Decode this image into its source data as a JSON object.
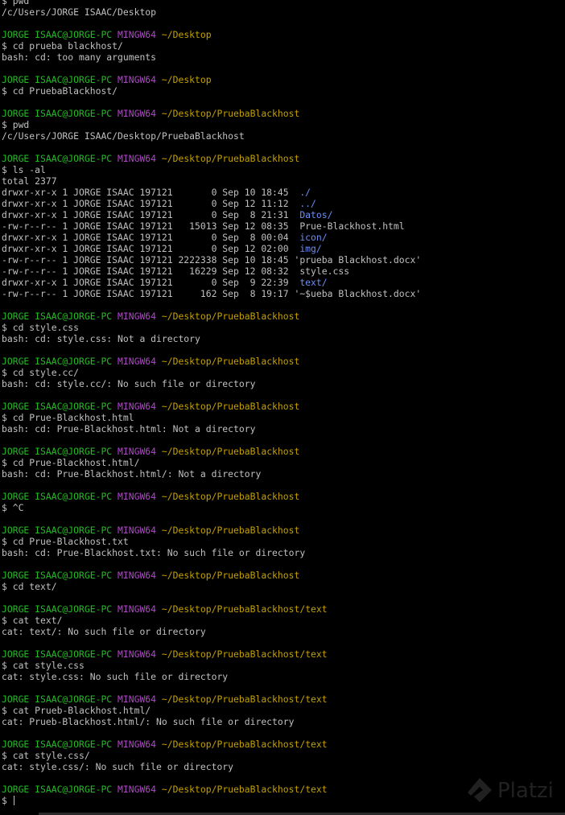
{
  "prompt": {
    "user": "JORGE ISAAC@JORGE-PC",
    "system": "MINGW64",
    "dollar": "$ "
  },
  "colors": {
    "background": "#000000",
    "text": "#c0c0c0",
    "user": "#24bc24",
    "system": "#b048c8",
    "path": "#c4a000",
    "directory": "#6b8ef2"
  },
  "session": [
    {
      "type": "cmd",
      "text": "pwd"
    },
    {
      "type": "out",
      "text": "/c/Users/JORGE ISAAC/Desktop"
    },
    {
      "type": "blank"
    },
    {
      "type": "prompt",
      "path": "~/Desktop"
    },
    {
      "type": "cmd",
      "text": "cd prueba blackhost/"
    },
    {
      "type": "out",
      "text": "bash: cd: too many arguments"
    },
    {
      "type": "blank"
    },
    {
      "type": "prompt",
      "path": "~/Desktop"
    },
    {
      "type": "cmd",
      "text": "cd PruebaBlackhost/"
    },
    {
      "type": "blank"
    },
    {
      "type": "prompt",
      "path": "~/Desktop/PruebaBlackhost"
    },
    {
      "type": "cmd",
      "text": "pwd"
    },
    {
      "type": "out",
      "text": "/c/Users/JORGE ISAAC/Desktop/PruebaBlackhost"
    },
    {
      "type": "blank"
    },
    {
      "type": "prompt",
      "path": "~/Desktop/PruebaBlackhost"
    },
    {
      "type": "cmd",
      "text": "ls -al"
    },
    {
      "type": "out",
      "text": "total 2377"
    },
    {
      "type": "ls",
      "meta": "drwxr-xr-x 1 JORGE ISAAC 197121       0 Sep 10 18:45  ",
      "name": "./",
      "dir": true
    },
    {
      "type": "ls",
      "meta": "drwxr-xr-x 1 JORGE ISAAC 197121       0 Sep 12 11:12  ",
      "name": "../",
      "dir": true
    },
    {
      "type": "ls",
      "meta": "drwxr-xr-x 1 JORGE ISAAC 197121       0 Sep  8 21:31  ",
      "name": "Datos/",
      "dir": true
    },
    {
      "type": "ls",
      "meta": "-rw-r--r-- 1 JORGE ISAAC 197121   15013 Sep 12 08:35  ",
      "name": "Prue-Blackhost.html",
      "dir": false
    },
    {
      "type": "ls",
      "meta": "drwxr-xr-x 1 JORGE ISAAC 197121       0 Sep  8 00:04  ",
      "name": "icon/",
      "dir": true
    },
    {
      "type": "ls",
      "meta": "drwxr-xr-x 1 JORGE ISAAC 197121       0 Sep 12 02:00  ",
      "name": "img/",
      "dir": true
    },
    {
      "type": "ls",
      "meta": "-rw-r--r-- 1 JORGE ISAAC 197121 2222338 Sep 10 18:45 ",
      "name": "'prueba Blackhost.docx'",
      "dir": false
    },
    {
      "type": "ls",
      "meta": "-rw-r--r-- 1 JORGE ISAAC 197121   16229 Sep 12 08:32  ",
      "name": "style.css",
      "dir": false
    },
    {
      "type": "ls",
      "meta": "drwxr-xr-x 1 JORGE ISAAC 197121       0 Sep  9 22:39  ",
      "name": "text/",
      "dir": true
    },
    {
      "type": "ls",
      "meta": "-rw-r--r-- 1 JORGE ISAAC 197121     162 Sep  8 19:17 ",
      "name": "'~$ueba Blackhost.docx'",
      "dir": false
    },
    {
      "type": "blank"
    },
    {
      "type": "prompt",
      "path": "~/Desktop/PruebaBlackhost"
    },
    {
      "type": "cmd",
      "text": "cd style.css"
    },
    {
      "type": "out",
      "text": "bash: cd: style.css: Not a directory"
    },
    {
      "type": "blank"
    },
    {
      "type": "prompt",
      "path": "~/Desktop/PruebaBlackhost"
    },
    {
      "type": "cmd",
      "text": "cd style.cc/"
    },
    {
      "type": "out",
      "text": "bash: cd: style.cc/: No such file or directory"
    },
    {
      "type": "blank"
    },
    {
      "type": "prompt",
      "path": "~/Desktop/PruebaBlackhost"
    },
    {
      "type": "cmd",
      "text": "cd Prue-Blackhost.html"
    },
    {
      "type": "out",
      "text": "bash: cd: Prue-Blackhost.html: Not a directory"
    },
    {
      "type": "blank"
    },
    {
      "type": "prompt",
      "path": "~/Desktop/PruebaBlackhost"
    },
    {
      "type": "cmd",
      "text": "cd Prue-Blackhost.html/"
    },
    {
      "type": "out",
      "text": "bash: cd: Prue-Blackhost.html/: Not a directory"
    },
    {
      "type": "blank"
    },
    {
      "type": "prompt",
      "path": "~/Desktop/PruebaBlackhost"
    },
    {
      "type": "cmd",
      "text": "^C"
    },
    {
      "type": "blank"
    },
    {
      "type": "prompt",
      "path": "~/Desktop/PruebaBlackhost"
    },
    {
      "type": "cmd",
      "text": "cd Prue-Blackhost.txt"
    },
    {
      "type": "out",
      "text": "bash: cd: Prue-Blackhost.txt: No such file or directory"
    },
    {
      "type": "blank"
    },
    {
      "type": "prompt",
      "path": "~/Desktop/PruebaBlackhost"
    },
    {
      "type": "cmd",
      "text": "cd text/"
    },
    {
      "type": "blank"
    },
    {
      "type": "prompt",
      "path": "~/Desktop/PruebaBlackhost/text"
    },
    {
      "type": "cmd",
      "text": "cat text/"
    },
    {
      "type": "out",
      "text": "cat: text/: No such file or directory"
    },
    {
      "type": "blank"
    },
    {
      "type": "prompt",
      "path": "~/Desktop/PruebaBlackhost/text"
    },
    {
      "type": "cmd",
      "text": "cat style.css"
    },
    {
      "type": "out",
      "text": "cat: style.css: No such file or directory"
    },
    {
      "type": "blank"
    },
    {
      "type": "prompt",
      "path": "~/Desktop/PruebaBlackhost/text"
    },
    {
      "type": "cmd",
      "text": "cat Prueb-Blackhost.html/"
    },
    {
      "type": "out",
      "text": "cat: Prueb-Blackhost.html/: No such file or directory"
    },
    {
      "type": "blank"
    },
    {
      "type": "prompt",
      "path": "~/Desktop/PruebaBlackhost/text"
    },
    {
      "type": "cmd",
      "text": "cat style.css/"
    },
    {
      "type": "out",
      "text": "cat: style.css/: No such file or directory"
    },
    {
      "type": "blank"
    },
    {
      "type": "prompt",
      "path": "~/Desktop/PruebaBlackhost/text"
    },
    {
      "type": "input",
      "text": ""
    }
  ],
  "watermark": {
    "icon": "platzi-logo-icon",
    "text": "Platzi"
  }
}
